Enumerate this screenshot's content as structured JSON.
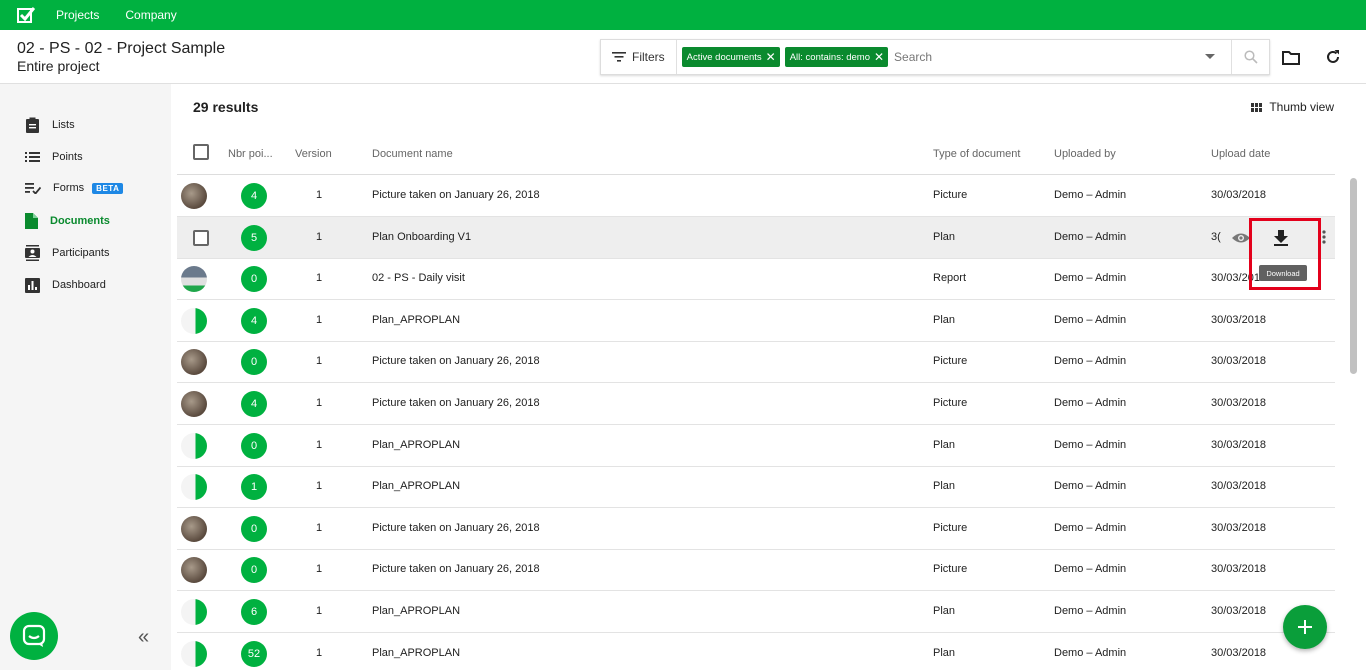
{
  "topbar": {
    "nav": [
      "Projects",
      "Company"
    ],
    "brand_color": "#00b140"
  },
  "header": {
    "project_title": "02 - PS - 02 - Project Sample",
    "project_scope": "Entire project",
    "filters_label": "Filters",
    "chips": [
      "Active documents",
      "All: contains: demo"
    ],
    "search_placeholder": "Search"
  },
  "sidebar": {
    "items": [
      {
        "label": "Lists",
        "icon": "clipboard-icon"
      },
      {
        "label": "Points",
        "icon": "list-icon"
      },
      {
        "label": "Forms",
        "icon": "checklist-icon",
        "badge": "BETA"
      },
      {
        "label": "Documents",
        "icon": "document-icon",
        "active": true
      },
      {
        "label": "Participants",
        "icon": "contacts-icon"
      },
      {
        "label": "Dashboard",
        "icon": "bar-chart-icon"
      }
    ]
  },
  "main": {
    "results": "29 results",
    "thumb_view": "Thumb view",
    "columns": [
      "Nbr poi...",
      "Version",
      "Document name",
      "Type of document",
      "Uploaded by",
      "Upload date"
    ],
    "rows": [
      {
        "points": "4",
        "version": "1",
        "name": "Picture taken on January 26, 2018",
        "type": "Picture",
        "uploader": "Demo – Admin",
        "date": "30/03/2018",
        "thumb": "photo"
      },
      {
        "points": "5",
        "version": "1",
        "name": "Plan Onboarding V1",
        "type": "Plan",
        "uploader": "Demo – Admin",
        "date": "3(",
        "thumb": "checkbox"
      },
      {
        "points": "0",
        "version": "1",
        "name": "02 - PS - Daily visit",
        "type": "Report",
        "uploader": "Demo – Admin",
        "date": "30/03/2018",
        "thumb": "report"
      },
      {
        "points": "4",
        "version": "1",
        "name": "Plan_APROPLAN",
        "type": "Plan",
        "uploader": "Demo – Admin",
        "date": "30/03/2018",
        "thumb": "plan"
      },
      {
        "points": "0",
        "version": "1",
        "name": "Picture taken on January 26, 2018",
        "type": "Picture",
        "uploader": "Demo – Admin",
        "date": "30/03/2018",
        "thumb": "photo"
      },
      {
        "points": "4",
        "version": "1",
        "name": "Picture taken on January 26, 2018",
        "type": "Picture",
        "uploader": "Demo – Admin",
        "date": "30/03/2018",
        "thumb": "photo"
      },
      {
        "points": "0",
        "version": "1",
        "name": "Plan_APROPLAN",
        "type": "Plan",
        "uploader": "Demo – Admin",
        "date": "30/03/2018",
        "thumb": "plan"
      },
      {
        "points": "1",
        "version": "1",
        "name": "Plan_APROPLAN",
        "type": "Plan",
        "uploader": "Demo – Admin",
        "date": "30/03/2018",
        "thumb": "plan"
      },
      {
        "points": "0",
        "version": "1",
        "name": "Picture taken on January 26, 2018",
        "type": "Picture",
        "uploader": "Demo – Admin",
        "date": "30/03/2018",
        "thumb": "photo"
      },
      {
        "points": "0",
        "version": "1",
        "name": "Picture taken on January 26, 2018",
        "type": "Picture",
        "uploader": "Demo – Admin",
        "date": "30/03/2018",
        "thumb": "photo"
      },
      {
        "points": "6",
        "version": "1",
        "name": "Plan_APROPLAN",
        "type": "Plan",
        "uploader": "Demo – Admin",
        "date": "30/03/2018",
        "thumb": "plan"
      },
      {
        "points": "52",
        "version": "1",
        "name": "Plan_APROPLAN",
        "type": "Plan",
        "uploader": "Demo – Admin",
        "date": "30/03/2018",
        "thumb": "plan"
      }
    ],
    "tooltip": "Download"
  }
}
